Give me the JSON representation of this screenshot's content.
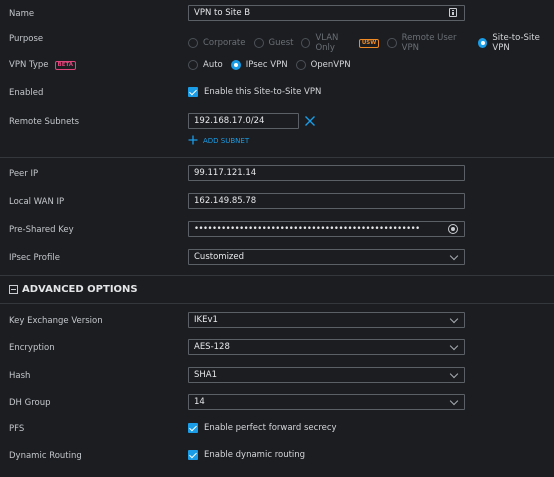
{
  "name": {
    "label": "Name",
    "value": "VPN to Site B"
  },
  "purpose": {
    "label": "Purpose",
    "options": [
      "Corporate",
      "Guest",
      "VLAN Only",
      "Remote User VPN",
      "Site-to-Site VPN"
    ],
    "vlan_badge": "USW",
    "selected": "Site-to-Site VPN"
  },
  "vpn_type": {
    "label": "VPN Type",
    "badge": "BETA",
    "options": [
      "Auto",
      "IPsec VPN",
      "OpenVPN"
    ],
    "selected": "IPsec VPN"
  },
  "enabled": {
    "label": "Enabled",
    "text": "Enable this Site-to-Site VPN",
    "checked": true
  },
  "remote_subnets": {
    "label": "Remote Subnets",
    "value": "192.168.17.0/24",
    "add_label": "ADD SUBNET"
  },
  "peer_ip": {
    "label": "Peer IP",
    "value": "99.117.121.14"
  },
  "local_wan_ip": {
    "label": "Local WAN IP",
    "value": "162.149.85.78"
  },
  "psk": {
    "label": "Pre-Shared Key",
    "value": "••••••••••••••••••••••••••••••••••••••••••••••••••"
  },
  "ipsec_profile": {
    "label": "IPsec Profile",
    "value": "Customized"
  },
  "advanced": {
    "title": "ADVANCED OPTIONS"
  },
  "key_exchange": {
    "label": "Key Exchange Version",
    "value": "IKEv1"
  },
  "encryption": {
    "label": "Encryption",
    "value": "AES-128"
  },
  "hash": {
    "label": "Hash",
    "value": "SHA1"
  },
  "dh_group": {
    "label": "DH Group",
    "value": "14"
  },
  "pfs": {
    "label": "PFS",
    "text": "Enable perfect forward secrecy",
    "checked": true
  },
  "dynamic_routing": {
    "label": "Dynamic Routing",
    "text": "Enable dynamic routing",
    "checked": true
  },
  "colors": {
    "accent": "#1a9ce6",
    "background": "#1b1d21",
    "border": "#5b6066",
    "badge": "#f08a24"
  }
}
